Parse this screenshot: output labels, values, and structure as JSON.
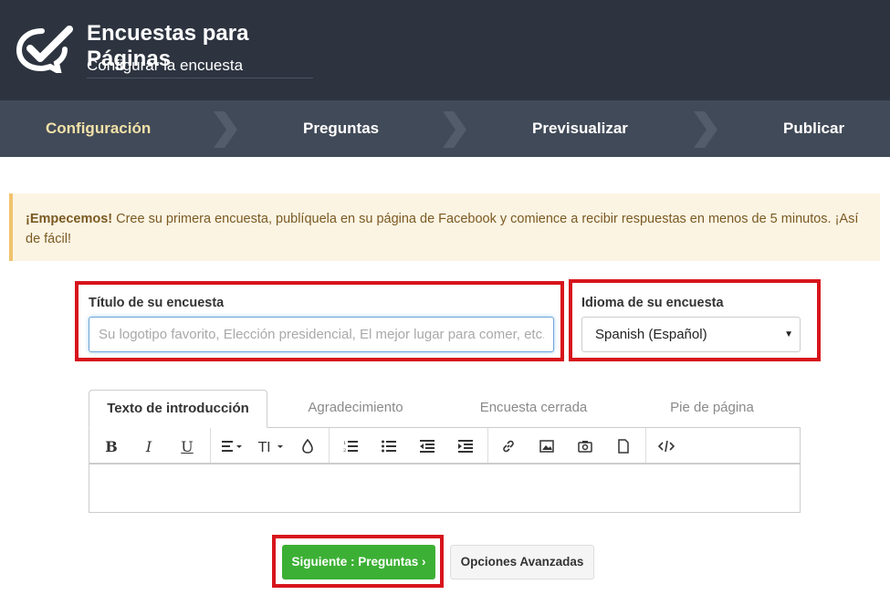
{
  "header": {
    "title": "Encuestas para Páginas",
    "subtitle": "Configurar la encuesta"
  },
  "steps": [
    {
      "label": "Configuración",
      "active": true
    },
    {
      "label": "Preguntas",
      "active": false
    },
    {
      "label": "Previsualizar",
      "active": false
    },
    {
      "label": "Publicar",
      "active": false
    }
  ],
  "alert": {
    "strong": "¡Empecemos!",
    "text": " Cree su primera encuesta, publíquela en su página de Facebook y comience a recibir respuestas en menos de 5 minutos. ¡Así de fácil!"
  },
  "form": {
    "title_label": "Título de su encuesta",
    "title_placeholder": "Su logotipo favorito, Elección presidencial, El mejor lugar para comer, etc.",
    "title_value": "",
    "language_label": "Idioma de su encuesta",
    "language_value": "Spanish (Español)"
  },
  "tabs": [
    {
      "label": "Texto de introducción",
      "active": true
    },
    {
      "label": "Agradecimiento",
      "active": false
    },
    {
      "label": "Encuesta cerrada",
      "active": false
    },
    {
      "label": "Pie de página",
      "active": false
    }
  ],
  "toolbar": {
    "icons": [
      "bold-icon",
      "italic-icon",
      "underline-icon",
      "align-icon",
      "font-size-icon",
      "color-icon",
      "ordered-list-icon",
      "unordered-list-icon",
      "outdent-icon",
      "indent-icon",
      "link-icon",
      "image-icon",
      "camera-icon",
      "file-icon",
      "code-icon"
    ],
    "bold": "B",
    "italic": "I",
    "underline": "U"
  },
  "editor": {
    "content": ""
  },
  "buttons": {
    "next": "Siguiente : Preguntas ›",
    "advanced": "Opciones Avanzadas"
  },
  "colors": {
    "header_bg": "#2d3440",
    "steps_bg": "#414a58",
    "active_step": "#f2e1a8",
    "alert_bg": "#fcf4e3",
    "alert_border": "#f0c36d",
    "highlight_red": "#d7141c",
    "primary_green": "#3cb034"
  }
}
